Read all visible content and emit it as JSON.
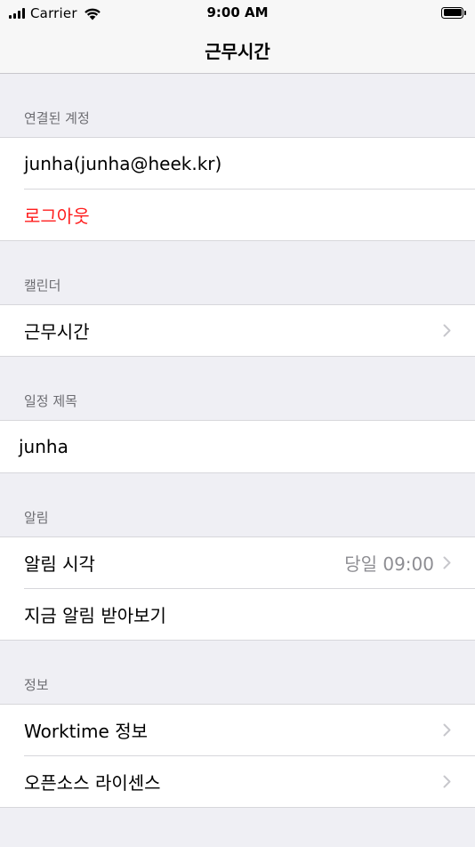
{
  "status_bar": {
    "carrier": "Carrier",
    "time": "9:00 AM"
  },
  "nav": {
    "title": "근무시간"
  },
  "sections": {
    "account": {
      "header": "연결된 계정",
      "account_name": "junha(junha@heek.kr)",
      "logout": "로그아웃"
    },
    "calendar": {
      "header": "캘린더",
      "calendar_name": "근무시간"
    },
    "event_title": {
      "header": "일정 제목",
      "value": "junha"
    },
    "alarm": {
      "header": "알림",
      "alarm_time_label": "알림 시각",
      "alarm_time_value": "당일 09:00",
      "test_alarm": "지금 알림 받아보기"
    },
    "info": {
      "header": "정보",
      "about": "Worktime 정보",
      "licenses": "오픈소스 라이센스"
    }
  },
  "colors": {
    "destructive": "#ff1e1e",
    "detail": "#8e8e93",
    "section_header": "#6d6d72",
    "background": "#efeff4"
  }
}
